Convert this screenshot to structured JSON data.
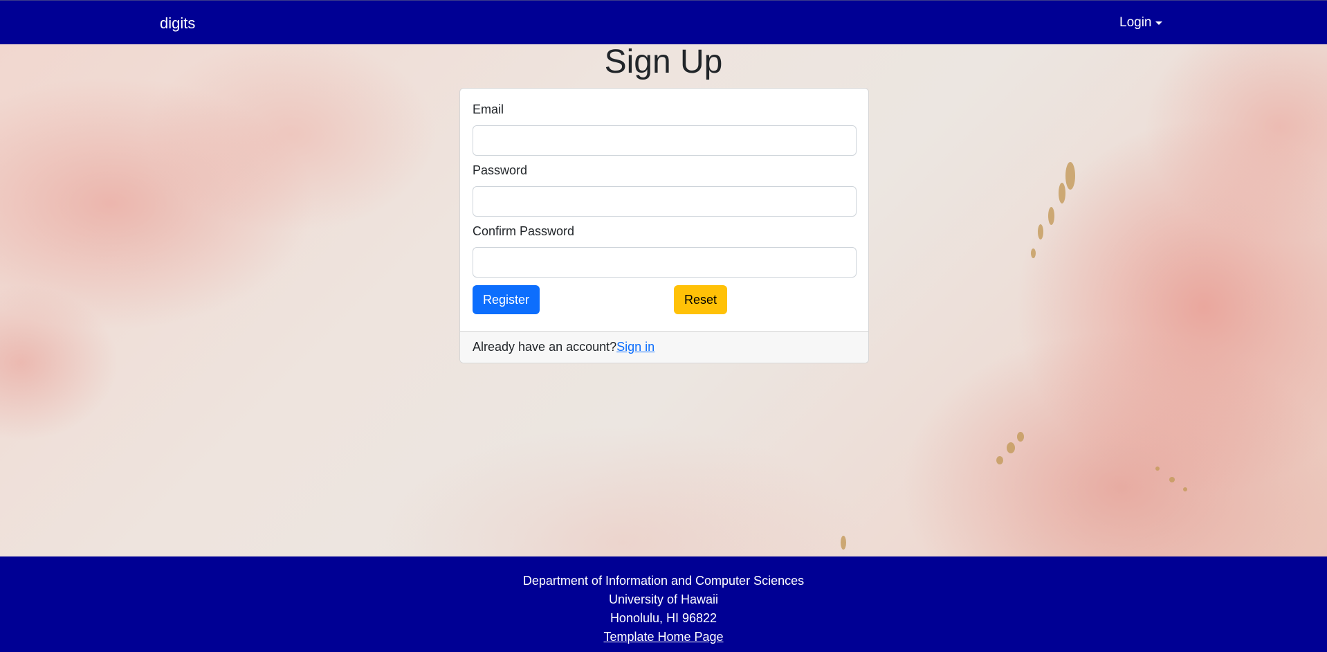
{
  "navbar": {
    "brand": "digits",
    "login_label": "Login"
  },
  "page": {
    "title": "Sign Up"
  },
  "form": {
    "email_label": "Email",
    "email_value": "",
    "password_label": "Password",
    "password_value": "",
    "confirm_label": "Confirm Password",
    "confirm_value": "",
    "register_label": "Register",
    "reset_label": "Reset"
  },
  "card_footer": {
    "prompt": "Already have an account?",
    "signin_label": "Sign in"
  },
  "footer": {
    "line1": "Department of Information and Computer Sciences",
    "line2": "University of Hawaii",
    "line3": "Honolulu, HI 96822",
    "link_label": "Template Home Page"
  },
  "colors": {
    "navbar_bg": "#000094",
    "primary": "#0d6efd",
    "warning": "#ffc107"
  }
}
